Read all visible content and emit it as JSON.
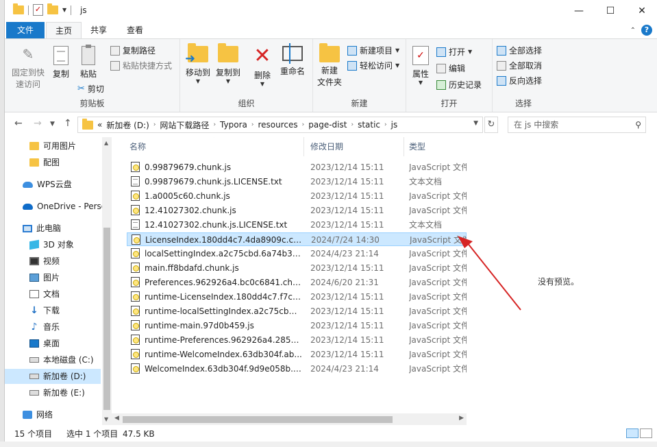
{
  "window": {
    "title": "js",
    "controls": {
      "minimize": "—",
      "maximize": "☐",
      "close": "✕"
    }
  },
  "tabs": {
    "file": "文件",
    "home": "主页",
    "share": "共享",
    "view": "查看"
  },
  "ribbon": {
    "clipboard": {
      "label": "剪贴板",
      "pin_quick": "固定到快\n速访问",
      "copy": "复制",
      "paste": "粘贴",
      "copy_path": "复制路径",
      "paste_shortcut": "粘贴快捷方式",
      "cut": "剪切"
    },
    "organize": {
      "label": "组织",
      "move_to": "移动到",
      "copy_to": "复制到",
      "delete": "删除",
      "rename": "重命名"
    },
    "new": {
      "label": "新建",
      "new_folder": "新建\n文件夹",
      "new_item": "新建项目",
      "easy_access": "轻松访问"
    },
    "open": {
      "label": "打开",
      "properties": "属性",
      "open": "打开",
      "edit": "编辑",
      "history": "历史记录"
    },
    "select": {
      "label": "选择",
      "select_all": "全部选择",
      "select_none": "全部取消",
      "invert": "反向选择"
    }
  },
  "address": {
    "prefix": "«",
    "crumbs": [
      "新加卷 (D:)",
      "网站下载路径",
      "Typora",
      "resources",
      "page-dist",
      "static",
      "js"
    ],
    "search_placeholder": "在 js 中搜索"
  },
  "nav": {
    "items": [
      {
        "label": "可用图片",
        "icon": "folder-icon"
      },
      {
        "label": "配图",
        "icon": "folder-icon"
      },
      {
        "label": "WPS云盘",
        "icon": "cloud-icon"
      },
      {
        "label": "OneDrive - Perso",
        "icon": "onedrive-icon"
      },
      {
        "label": "此电脑",
        "icon": "computer-icon"
      },
      {
        "label": "3D 对象",
        "icon": "cube-icon"
      },
      {
        "label": "视频",
        "icon": "video-icon"
      },
      {
        "label": "图片",
        "icon": "picture-icon"
      },
      {
        "label": "文档",
        "icon": "document-icon"
      },
      {
        "label": "下载",
        "icon": "download-icon"
      },
      {
        "label": "音乐",
        "icon": "music-icon"
      },
      {
        "label": "桌面",
        "icon": "desktop-icon"
      },
      {
        "label": "本地磁盘 (C:)",
        "icon": "drive-icon"
      },
      {
        "label": "新加卷 (D:)",
        "icon": "drive-icon"
      },
      {
        "label": "新加卷 (E:)",
        "icon": "drive-icon"
      },
      {
        "label": "网络",
        "icon": "network-icon"
      }
    ]
  },
  "filelist": {
    "columns": {
      "name": "名称",
      "date": "修改日期",
      "type": "类型"
    },
    "rows": [
      {
        "name": "0.99879679.chunk.js",
        "date": "2023/12/14 15:11",
        "type": "JavaScript 文件",
        "kind": "js"
      },
      {
        "name": "0.99879679.chunk.js.LICENSE.txt",
        "date": "2023/12/14 15:11",
        "type": "文本文档",
        "kind": "txt"
      },
      {
        "name": "1.a0005c60.chunk.js",
        "date": "2023/12/14 15:11",
        "type": "JavaScript 文件",
        "kind": "js"
      },
      {
        "name": "12.41027302.chunk.js",
        "date": "2023/12/14 15:11",
        "type": "JavaScript 文件",
        "kind": "js"
      },
      {
        "name": "12.41027302.chunk.js.LICENSE.txt",
        "date": "2023/12/14 15:11",
        "type": "文本文档",
        "kind": "txt"
      },
      {
        "name": "LicenseIndex.180dd4c7.4da8909c.chu...",
        "date": "2024/7/24 14:30",
        "type": "JavaScript 文件",
        "kind": "js",
        "selected": true
      },
      {
        "name": "localSettingIndex.a2c75cbd.6a74b30...",
        "date": "2024/4/23 21:14",
        "type": "JavaScript 文件",
        "kind": "js"
      },
      {
        "name": "main.ff8bdafd.chunk.js",
        "date": "2023/12/14 15:11",
        "type": "JavaScript 文件",
        "kind": "js"
      },
      {
        "name": "Preferences.962926a4.bc0c6841.chun...",
        "date": "2024/6/20 21:31",
        "type": "JavaScript 文件",
        "kind": "js"
      },
      {
        "name": "runtime-LicenseIndex.180dd4c7.f7c00...",
        "date": "2023/12/14 15:11",
        "type": "JavaScript 文件",
        "kind": "js"
      },
      {
        "name": "runtime-localSettingIndex.a2c75cbd.6...",
        "date": "2023/12/14 15:11",
        "type": "JavaScript 文件",
        "kind": "js"
      },
      {
        "name": "runtime-main.97d0b459.js",
        "date": "2023/12/14 15:11",
        "type": "JavaScript 文件",
        "kind": "js"
      },
      {
        "name": "runtime-Preferences.962926a4.285ea...",
        "date": "2023/12/14 15:11",
        "type": "JavaScript 文件",
        "kind": "js"
      },
      {
        "name": "runtime-WelcomeIndex.63db304f.ab...",
        "date": "2023/12/14 15:11",
        "type": "JavaScript 文件",
        "kind": "js"
      },
      {
        "name": "WelcomeIndex.63db304f.9d9e058b.c...",
        "date": "2024/4/23 21:14",
        "type": "JavaScript 文件",
        "kind": "js"
      }
    ]
  },
  "preview": {
    "text": "没有预览。"
  },
  "status": {
    "count": "15 个项目",
    "selected": "选中 1 个项目",
    "size": "47.5 KB"
  },
  "colors": {
    "accent": "#1979ca",
    "selection": "#cce8ff",
    "annotation": "#d62424"
  }
}
